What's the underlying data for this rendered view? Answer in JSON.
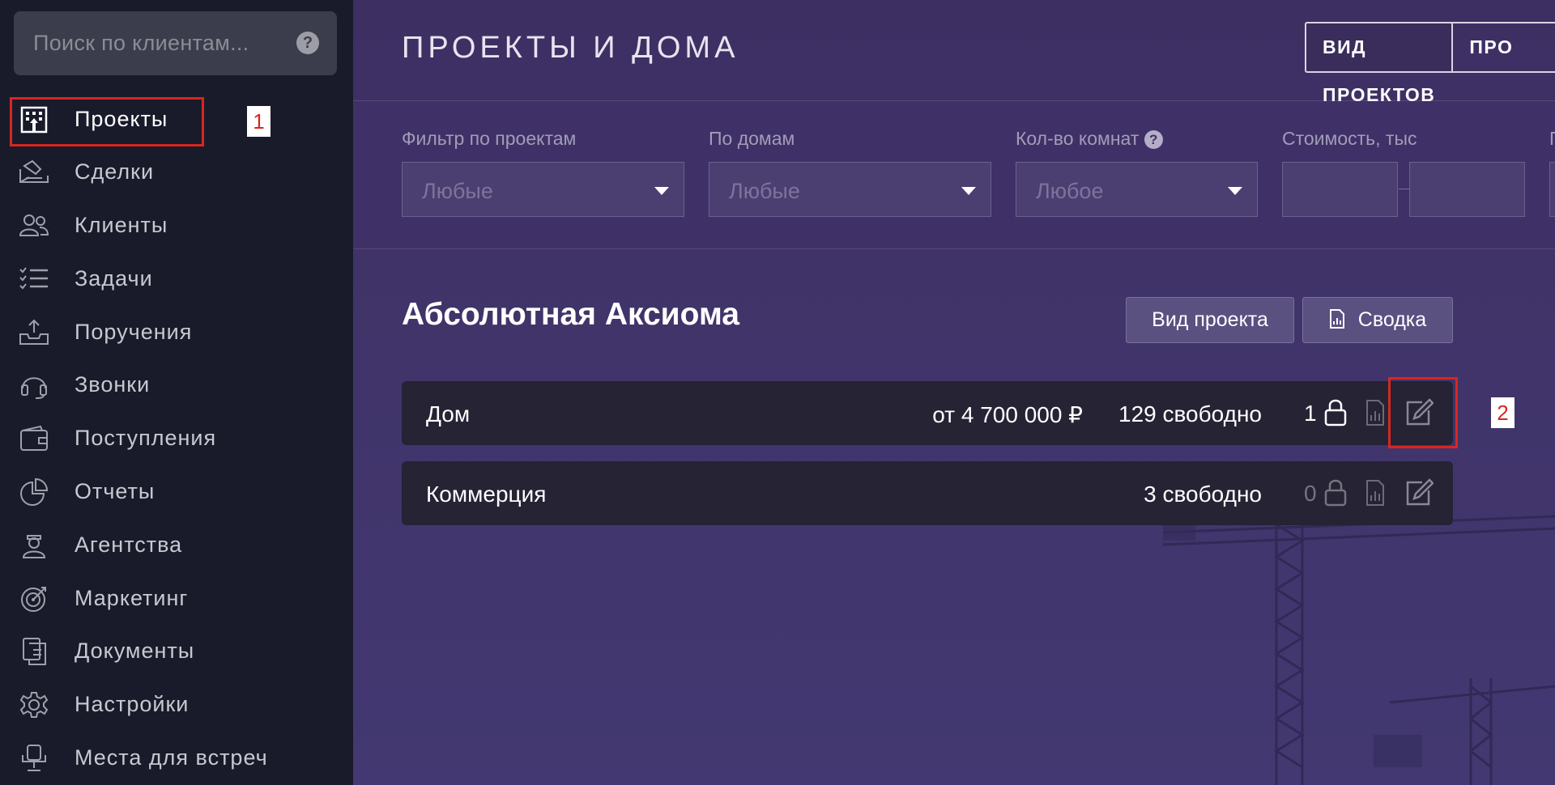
{
  "sidebar": {
    "search": {
      "placeholder": "Поиск по клиентам...",
      "help_icon": "question-circle-icon"
    },
    "items": [
      {
        "label": "Проекты",
        "icon": "building-icon",
        "active": true
      },
      {
        "label": "Сделки",
        "icon": "handshake-icon"
      },
      {
        "label": "Клиенты",
        "icon": "users-icon"
      },
      {
        "label": "Задачи",
        "icon": "task-list-icon"
      },
      {
        "label": "Поручения",
        "icon": "inbox-upload-icon"
      },
      {
        "label": "Звонки",
        "icon": "headset-icon"
      },
      {
        "label": "Поступления",
        "icon": "wallet-icon"
      },
      {
        "label": "Отчеты",
        "icon": "pie-chart-icon"
      },
      {
        "label": "Агентства",
        "icon": "agent-icon"
      },
      {
        "label": "Маркетинг",
        "icon": "target-icon"
      },
      {
        "label": "Документы",
        "icon": "documents-icon"
      },
      {
        "label": "Настройки",
        "icon": "gear-icon"
      },
      {
        "label": "Места для встреч",
        "icon": "meeting-place-icon"
      }
    ]
  },
  "annotations": {
    "one": "1",
    "two": "2",
    "color": "#d8261f"
  },
  "header": {
    "title": "ПРОЕКТЫ И ДОМА",
    "view_projects": "ВИД ПРОЕКТОВ",
    "view_other": "ПРО"
  },
  "filters": {
    "projects": {
      "label": "Фильтр по проектам",
      "value": "Любые"
    },
    "houses": {
      "label": "По домам",
      "value": "Любые"
    },
    "rooms": {
      "label": "Кол-во комнат",
      "value": "Любое"
    },
    "cost": {
      "label": "Стоимость, тыс"
    },
    "extra": {
      "label": "П"
    }
  },
  "project": {
    "title": "Абсолютная Аксиома",
    "view_button": "Вид проекта",
    "summary_button": "Сводка",
    "houses": [
      {
        "name": "Дом",
        "price": "от 4 700 000 ₽",
        "free": "129 свободно",
        "locked": "1"
      },
      {
        "name": "Коммерция",
        "price": "",
        "free": "3 свободно",
        "locked": "0"
      }
    ]
  },
  "colors": {
    "sidebar_bg": "#191b2b",
    "main_bg": "#3f3266",
    "row_bg": "#252334",
    "annotation": "#d8261f"
  }
}
